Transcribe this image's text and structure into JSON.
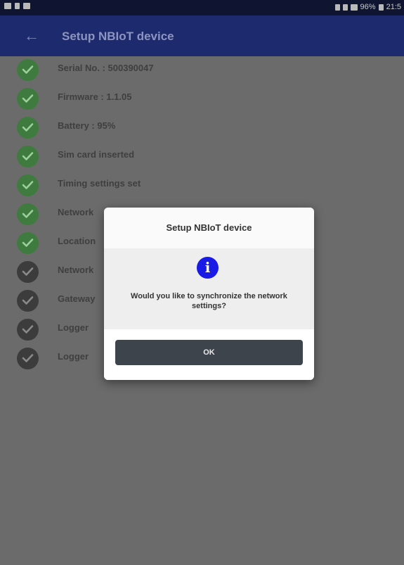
{
  "status_bar": {
    "right_text": "96%",
    "time": "21:5"
  },
  "toolbar": {
    "title": "Setup NBIoT device",
    "back_icon": "arrow-left-icon"
  },
  "checklist": [
    {
      "label": "Serial No. : 500390047",
      "state": "done"
    },
    {
      "label": "Firmware : 1.1.05",
      "state": "done"
    },
    {
      "label": "Battery : 95%",
      "state": "done"
    },
    {
      "label": "Sim card inserted",
      "state": "done"
    },
    {
      "label": "Timing settings set",
      "state": "done"
    },
    {
      "label": "Network",
      "state": "done"
    },
    {
      "label": "Location",
      "state": "done"
    },
    {
      "label": "Network",
      "state": "pending"
    },
    {
      "label": "Gateway",
      "state": "pending"
    },
    {
      "label": "Logger",
      "state": "pending"
    },
    {
      "label": "Logger",
      "state": "pending"
    }
  ],
  "dialog": {
    "title": "Setup NBIoT device",
    "icon": "info-icon",
    "icon_glyph": "i",
    "message": "Would you like to synchronize the network settings?",
    "ok_label": "OK"
  },
  "colors": {
    "toolbar": "#1e2a6e",
    "done": "#3f7a3f",
    "pending": "#3c3c3c",
    "ok_button": "#3e444c",
    "info": "#1a1ae6"
  }
}
